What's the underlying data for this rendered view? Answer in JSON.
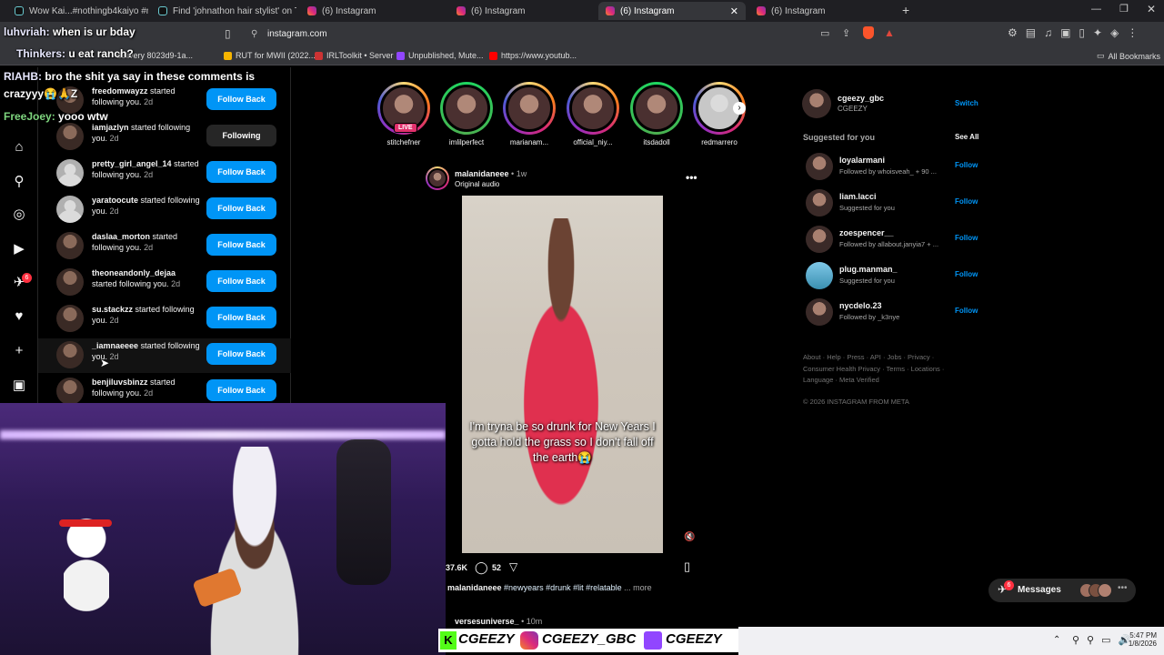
{
  "browser": {
    "tabs": [
      {
        "label": "Wow Kai...#nothingb4kaiyo #nb4 #",
        "icon": "tiktok-icon"
      },
      {
        "label": "Find 'johnathon hair stylist' on TikTo",
        "icon": "tiktok-icon"
      },
      {
        "label": "(6) Instagram",
        "icon": "instagram-icon"
      },
      {
        "label": "(6) Instagram",
        "icon": "instagram-icon"
      },
      {
        "label": "(6) Instagram",
        "icon": "instagram-icon",
        "active": true
      },
      {
        "label": "(6) Instagram",
        "icon": "instagram-icon"
      }
    ],
    "url": "instagram.com",
    "bookmarks": [
      "delivery 8023d9-1a...",
      "RUT for MWII (2022...",
      "IRLToolkit • Server",
      "Unpublished, Mute...",
      "https://www.youtub...",
      "All Bookmarks"
    ]
  },
  "chat_overlay": [
    {
      "user": "luhvriah:",
      "msg": "when is ur bday"
    },
    {
      "user": "Thinkers:",
      "msg": "u eat ranch?"
    },
    {
      "user": "RIAHB:",
      "msg": "bro the shit ya say in these comments is"
    },
    {
      "user": "",
      "msg": "crazyyy😭🙏Z"
    },
    {
      "user": "FreeJoey:",
      "msg": "yooo wtw"
    }
  ],
  "notifications": [
    {
      "user": "freedomwayzz",
      "text": "started following you.",
      "time": "2d",
      "button": "Follow Back"
    },
    {
      "user": "iamjazlyn",
      "text": "started following you.",
      "time": "2d",
      "button": "Following"
    },
    {
      "user": "pretty_girl_angel_14",
      "text": "started following you.",
      "time": "2d",
      "button": "Follow Back"
    },
    {
      "user": "yaratoocute",
      "text": "started following you.",
      "time": "2d",
      "button": "Follow Back"
    },
    {
      "user": "daslaa_morton",
      "text": "started following you.",
      "time": "2d",
      "button": "Follow Back"
    },
    {
      "user": "theoneandonly_dejaa",
      "text": "started following you.",
      "time": "2d",
      "button": "Follow Back"
    },
    {
      "user": "su.stackzz",
      "text": "started following you.",
      "time": "2d",
      "button": "Follow Back"
    },
    {
      "user": "_iamnaeeee",
      "text": "started following you.",
      "time": "2d",
      "button": "Follow Back"
    },
    {
      "user": "benjiluvsbinzz",
      "text": "started following you.",
      "time": "2d",
      "button": "Follow Back"
    }
  ],
  "nav_badge": "6",
  "stories": [
    {
      "name": "stitchefner",
      "live": "LIVE"
    },
    {
      "name": "imlilperfect"
    },
    {
      "name": "marianam..."
    },
    {
      "name": "official_niy..."
    },
    {
      "name": "itsdadoll"
    },
    {
      "name": "redmarrero"
    }
  ],
  "post": {
    "author": "malanidaneee",
    "time": "1w",
    "audio": "Original audio",
    "caption_overlay": "I'm tryna be so drunk for New Years I gotta hold the grass so I don't fall off the earth😭",
    "likes": "37.6K",
    "comments": "52",
    "caption_user": "malanidaneee",
    "hashtags": "#newyears #drunk #lit #relatable",
    "more": "... more",
    "next_author": "versesuniverse_",
    "next_time": "10m"
  },
  "account": {
    "username": "cgeezy_gbc",
    "name": "CGEEZY",
    "switch": "Switch"
  },
  "suggested": {
    "title": "Suggested for you",
    "see_all": "See All",
    "items": [
      {
        "user": "loyalarmani",
        "sub": "Followed by whoisveah_ + 90 ...",
        "action": "Follow"
      },
      {
        "user": "liam.lacci",
        "sub": "Suggested for you",
        "action": "Follow"
      },
      {
        "user": "zoespencer__",
        "sub": "Followed by allabout.janyia7 + ...",
        "action": "Follow"
      },
      {
        "user": "plug.manman_",
        "sub": "Suggested for you",
        "action": "Follow"
      },
      {
        "user": "nycdelo.23",
        "sub": "Followed by _k3nye",
        "action": "Follow"
      }
    ]
  },
  "footer": {
    "links1": "About · Help · Press · API · Jobs · Privacy ·",
    "links2": "Consumer Health Privacy · Terms · Locations ·",
    "links3": "Language · Meta Verified",
    "copyright": "© 2026 INSTAGRAM FROM META"
  },
  "messages": {
    "label": "Messages",
    "badge": "6"
  },
  "social_bar": {
    "kick": "CGEEZY",
    "instagram": "CGEEZY_GBC",
    "twitch": "CGEEZY"
  },
  "taskbar": {
    "time": "5:47 PM",
    "date": "1/8/2026"
  }
}
